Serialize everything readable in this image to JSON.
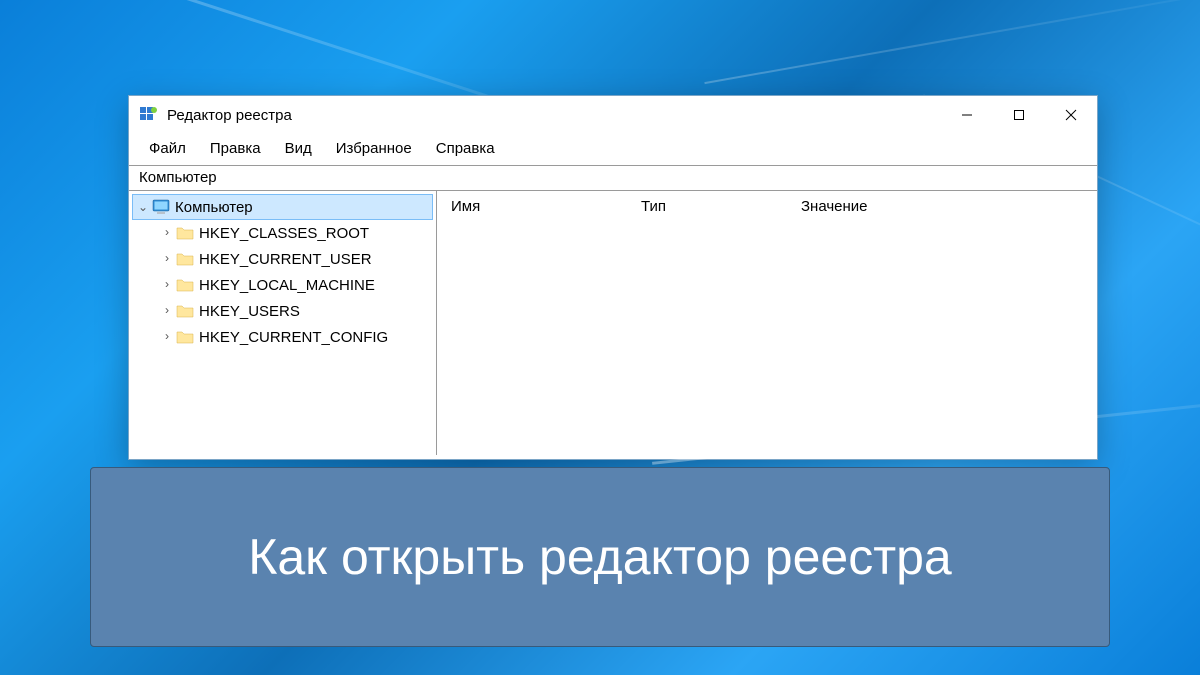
{
  "window": {
    "title": "Редактор реестра",
    "menu": {
      "file": "Файл",
      "edit": "Правка",
      "view": "Вид",
      "favorites": "Избранное",
      "help": "Справка"
    },
    "address": "Компьютер"
  },
  "tree": {
    "root": "Компьютер",
    "hives": [
      "HKEY_CLASSES_ROOT",
      "HKEY_CURRENT_USER",
      "HKEY_LOCAL_MACHINE",
      "HKEY_USERS",
      "HKEY_CURRENT_CONFIG"
    ]
  },
  "columns": {
    "name": "Имя",
    "type": "Тип",
    "value": "Значение"
  },
  "banner": {
    "text": "Как открыть редактор реестра"
  }
}
